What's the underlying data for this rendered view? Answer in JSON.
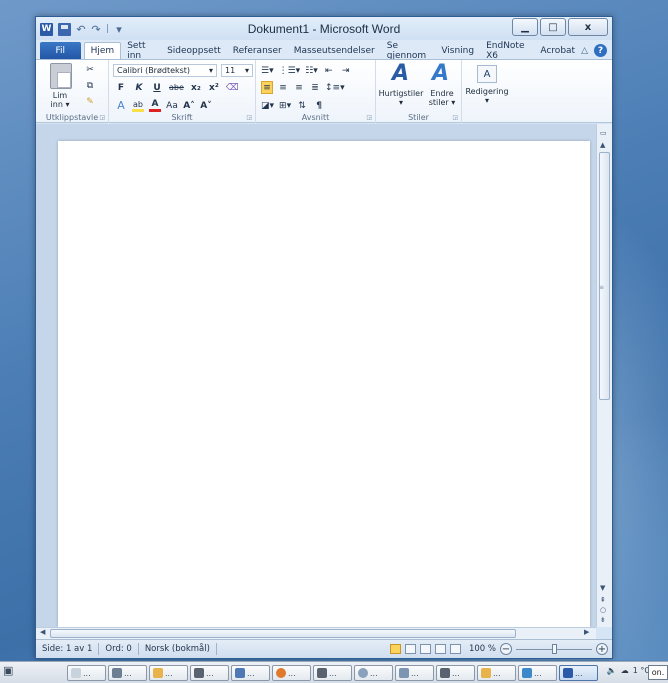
{
  "window": {
    "title": "Dokument1 - Microsoft Word",
    "qat_separator": "|",
    "minimize": "▁",
    "maximize": "□",
    "close": "x",
    "word_logo": "W"
  },
  "tabs": {
    "file": "Fil",
    "items": [
      "Hjem",
      "Sett inn",
      "Sideoppsett",
      "Referanser",
      "Masseutsendelser",
      "Se gjennom",
      "Visning",
      "EndNote X6",
      "Acrobat"
    ],
    "help": "?"
  },
  "ribbon": {
    "clipboard": {
      "label": "Utklippstavle",
      "paste": "Lim\ninn",
      "paste_line1": "Lim",
      "paste_line2": "inn ▾"
    },
    "font": {
      "label": "Skrift",
      "family": "Calibri (Brødtekst)",
      "size": "11",
      "bold": "F",
      "italic": "K",
      "underline": "U",
      "strike": "abe",
      "sub": "x₂",
      "sup": "x²",
      "case": "Aa",
      "grow": "A˄",
      "shrink": "A˅"
    },
    "paragraph": {
      "label": "Avsnitt",
      "pilcrow": "¶"
    },
    "styles": {
      "label": "Stiler",
      "quick": "Hurtigstiler",
      "change_line1": "Endre",
      "change_line2": "stiler ▾"
    },
    "editing": {
      "label": "Redigering",
      "find_glyph": "A"
    }
  },
  "statusbar": {
    "page": "Side: 1 av 1",
    "words": "Ord: 0",
    "language": "Norsk (bokmål)",
    "zoom": "100 %",
    "zoom_minus": "−",
    "zoom_plus": "+"
  },
  "taskbar": {
    "button_text": "...",
    "buttons": 13,
    "temp": "1 °C",
    "tray_text": "on."
  },
  "colors": {
    "file_tab": "#2356a6",
    "accent_active": "#fbd25a",
    "desktop": "#4d7fb6"
  }
}
